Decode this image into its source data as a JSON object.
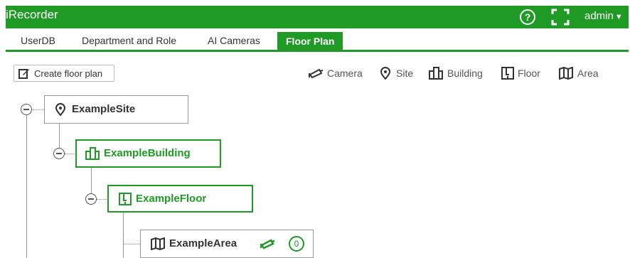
{
  "app": {
    "title": "iRecorder",
    "user": "admin"
  },
  "tabs": [
    {
      "label": "UserDB"
    },
    {
      "label": "Department and Role"
    },
    {
      "label": "AI Cameras"
    },
    {
      "label": "Floor Plan",
      "active": true
    }
  ],
  "toolbar": {
    "create_label": "Create floor plan"
  },
  "legend": [
    {
      "label": "Camera",
      "icon": "camera-icon"
    },
    {
      "label": "Site",
      "icon": "location-pin-icon"
    },
    {
      "label": "Building",
      "icon": "building-icon"
    },
    {
      "label": "Floor",
      "icon": "floor-icon"
    },
    {
      "label": "Area",
      "icon": "map-icon"
    }
  ],
  "tree": {
    "site": "ExampleSite",
    "building": "ExampleBuilding",
    "floor": "ExampleFloor",
    "area": {
      "label": "ExampleArea",
      "camera_count": "0"
    }
  },
  "colors": {
    "accent": "#1e9a25",
    "border": "#999999"
  }
}
